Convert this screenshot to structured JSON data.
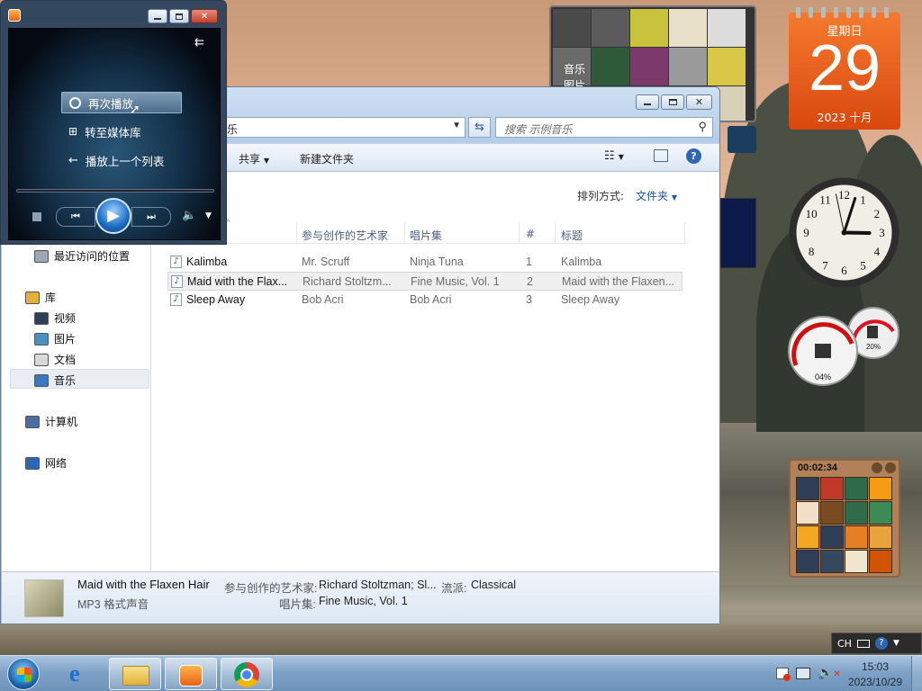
{
  "explorer": {
    "address_tail": "乐",
    "search_placeholder": "搜索 示例音乐",
    "toolbar": {
      "share": "共享",
      "new_folder": "新建文件夹"
    },
    "arrange_label": "排列方式:",
    "arrange_value": "文件夹",
    "nav": [
      {
        "label": "最近访问的位置",
        "icon": "recent-places-icon"
      },
      {
        "label": "库",
        "icon": "library-icon"
      },
      {
        "label": "视频",
        "icon": "video-icon"
      },
      {
        "label": "图片",
        "icon": "pictures-icon"
      },
      {
        "label": "文档",
        "icon": "documents-icon"
      },
      {
        "label": "音乐",
        "icon": "music-icon"
      },
      {
        "label": "计算机",
        "icon": "computer-icon"
      },
      {
        "label": "网络",
        "icon": "network-icon"
      }
    ],
    "columns": {
      "artist": "参与创作的艺术家",
      "album": "唱片集",
      "track": "#",
      "title": "标题"
    },
    "files": [
      {
        "name": "Kalimba",
        "artist": "Mr. Scruff",
        "album": "Ninja Tuna",
        "track": "1",
        "title": "Kalimba"
      },
      {
        "name": "Maid with the Flax...",
        "artist": "Richard Stoltzm...",
        "album": "Fine Music, Vol. 1",
        "track": "2",
        "title": "Maid with the Flaxen..."
      },
      {
        "name": "Sleep Away",
        "artist": "Bob Acri",
        "album": "Bob Acri",
        "track": "3",
        "title": "Sleep Away"
      }
    ],
    "details": {
      "title": "Maid with the Flaxen Hair",
      "artist_label": "参与创作的艺术家:",
      "artist_value": "Richard Stoltzman; Sl...",
      "genre_label": "流派:",
      "genre_value": "Classical",
      "type": "MP3 格式声音",
      "album_label": "唱片集:",
      "album_value": "Fine Music, Vol. 1"
    }
  },
  "wmp": {
    "menu": [
      {
        "label": "再次播放",
        "icon": "replay-icon"
      },
      {
        "label": "转至媒体库",
        "icon": "library-switch-icon"
      },
      {
        "label": "播放上一个列表",
        "icon": "back-arrow-icon"
      }
    ]
  },
  "gadgets": {
    "calendar": {
      "weekday": "星期日",
      "day": "29",
      "year_month": "2023 十月"
    },
    "gallery_labels": [
      "音乐",
      "图片"
    ],
    "cpu_meter": {
      "cpu": "04%",
      "memory": "20%"
    },
    "puzzle_timer": "00:02:34",
    "clock": {
      "hour": 3,
      "minute": 2,
      "second": 58
    }
  },
  "taskbar": {
    "lang": "CH",
    "time": "15:03",
    "date": "2023/10/29"
  },
  "colors": {
    "calendar_orange": "#e8621b",
    "wmp_dark": "#0a1622",
    "selection_gray": "#f0f0f0"
  }
}
